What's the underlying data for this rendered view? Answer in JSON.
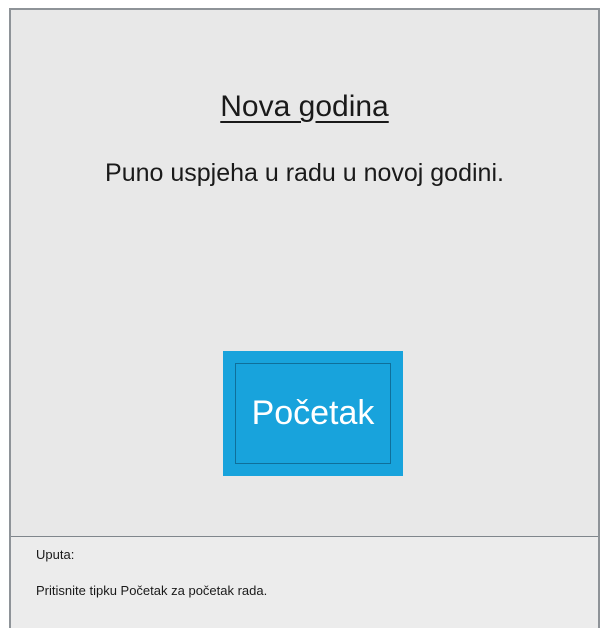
{
  "main": {
    "title": "Nova godina",
    "message": "Puno uspjeha u radu u novoj godini.",
    "start_button_label": "Početak"
  },
  "hint": {
    "heading": "Uputa:",
    "text": "Pritisnite tipku Početak za početak rada."
  },
  "colors": {
    "background": "#e8e8e8",
    "button": "#18a3dc",
    "button_text": "#ffffff",
    "border": "#8e9398"
  }
}
